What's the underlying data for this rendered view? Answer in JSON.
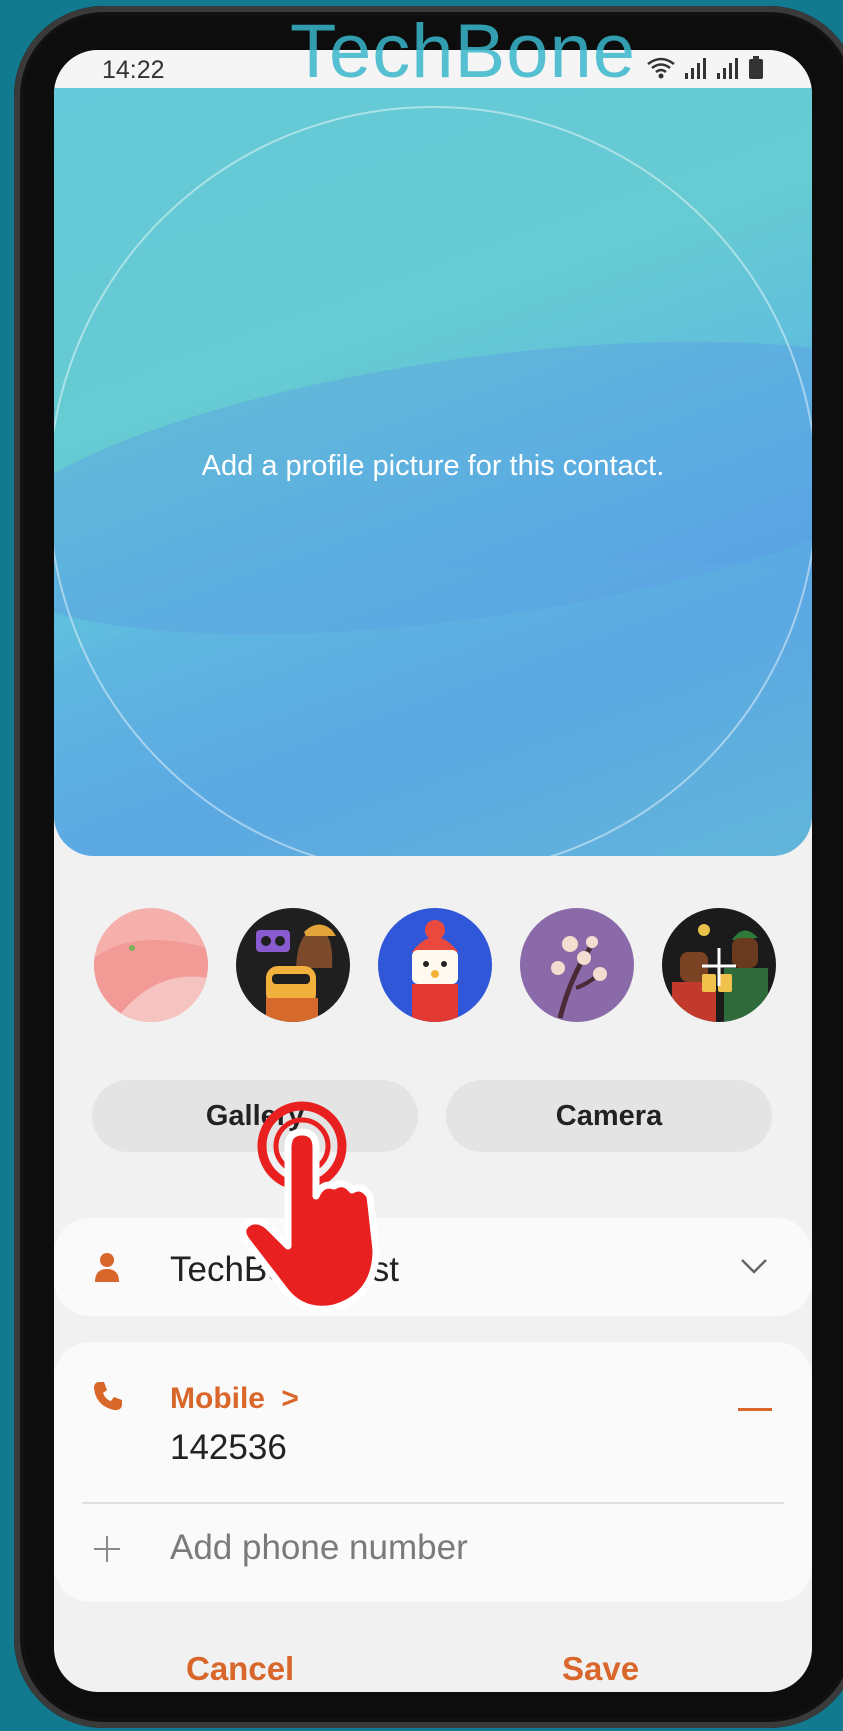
{
  "status_bar": {
    "time": "14:22"
  },
  "watermark": "TechBone",
  "hero": {
    "prompt": "Add a profile picture for this contact."
  },
  "presets": [
    {
      "name": "pink-dunes-avatar"
    },
    {
      "name": "boombox-characters-avatar"
    },
    {
      "name": "hat-character-avatar"
    },
    {
      "name": "blossom-branch-avatar"
    },
    {
      "name": "night-toast-avatar"
    }
  ],
  "buttons": {
    "gallery": "Gallery",
    "camera": "Camera"
  },
  "name_card": {
    "name": "TechBone Test"
  },
  "phone_card": {
    "type_label": "Mobile",
    "type_chevron": ">",
    "number": "142536",
    "add_label": "Add phone number"
  },
  "footer": {
    "cancel": "Cancel",
    "save": "Save"
  },
  "colors": {
    "accent": "#d9662a",
    "background": "#117a8e",
    "screen": "#f1f1f1",
    "tap_indicator": "#e82020"
  },
  "icons": [
    "wifi-icon",
    "signal-icon",
    "battery-icon",
    "person-icon",
    "chevron-down-icon",
    "phone-icon",
    "plus-icon",
    "tap-hand-icon"
  ]
}
